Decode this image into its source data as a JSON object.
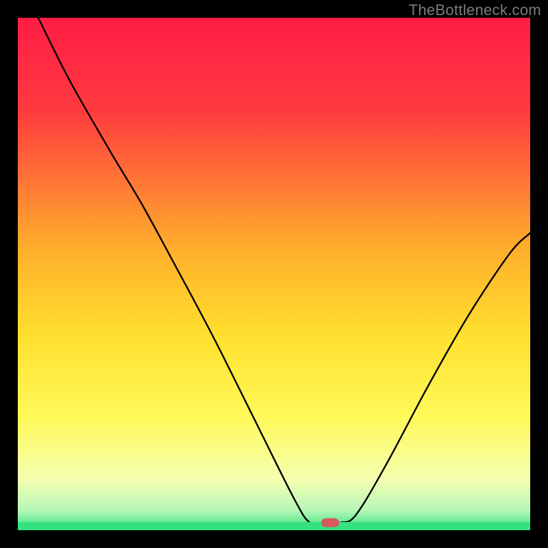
{
  "watermark_text": "TheBottleneck.com",
  "chart_data": {
    "type": "line",
    "title": "",
    "xlabel": "",
    "ylabel": "",
    "x_range": [
      0,
      100
    ],
    "y_range": [
      0,
      100
    ],
    "curve_points": [
      {
        "x": 4,
        "y": 100
      },
      {
        "x": 10,
        "y": 88
      },
      {
        "x": 18,
        "y": 74
      },
      {
        "x": 24,
        "y": 64
      },
      {
        "x": 30,
        "y": 53
      },
      {
        "x": 38,
        "y": 38
      },
      {
        "x": 46,
        "y": 22
      },
      {
        "x": 54,
        "y": 6
      },
      {
        "x": 57,
        "y": 1.5
      },
      {
        "x": 60,
        "y": 1.5
      },
      {
        "x": 63,
        "y": 1.5
      },
      {
        "x": 66,
        "y": 3
      },
      {
        "x": 72,
        "y": 13
      },
      {
        "x": 80,
        "y": 28
      },
      {
        "x": 88,
        "y": 42
      },
      {
        "x": 96,
        "y": 54
      },
      {
        "x": 100,
        "y": 58
      }
    ],
    "minimum_marker": {
      "x": 61,
      "y": 1.5
    },
    "gradient_stops": [
      {
        "offset": 0,
        "color": "#ff1d46"
      },
      {
        "offset": 18,
        "color": "#ff3a3f"
      },
      {
        "offset": 45,
        "color": "#ffae2b"
      },
      {
        "offset": 62,
        "color": "#ffe02f"
      },
      {
        "offset": 78,
        "color": "#fff95a"
      },
      {
        "offset": 90,
        "color": "#f5ffb0"
      },
      {
        "offset": 96,
        "color": "#b8f7b8"
      },
      {
        "offset": 100,
        "color": "#35e27f"
      }
    ],
    "baseline_band_height_pct": 1.6
  }
}
